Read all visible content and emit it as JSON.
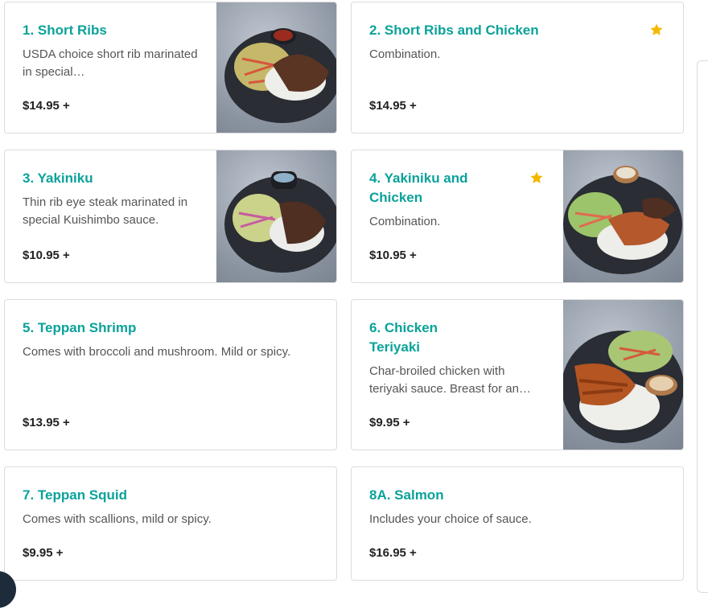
{
  "menu_items": [
    {
      "title": "1. Short Ribs",
      "description": "USDA choice short rib marinated in special…",
      "price": "$14.95 +",
      "starred": false,
      "has_photo": true
    },
    {
      "title": "2. Short Ribs and Chicken",
      "description": "Combination.",
      "price": "$14.95 +",
      "starred": true,
      "has_photo": false
    },
    {
      "title": "3. Yakiniku",
      "description": "Thin rib eye steak marinated in special Kuishimbo sauce.",
      "price": "$10.95 +",
      "starred": false,
      "has_photo": true
    },
    {
      "title": "4. Yakiniku and Chicken",
      "description": "Combination.",
      "price": "$10.95 +",
      "starred": true,
      "has_photo": true
    },
    {
      "title": "5. Teppan Shrimp",
      "description": "Comes with broccoli and mushroom. Mild or spicy.",
      "price": "$13.95 +",
      "starred": false,
      "has_photo": false
    },
    {
      "title": "6. Chicken Teriyaki",
      "description": "Char-broiled chicken with teriyaki sauce. Breast for an…",
      "price": "$9.95 +",
      "starred": false,
      "has_photo": true
    },
    {
      "title": "7. Teppan Squid",
      "description": "Comes with scallions, mild or spicy.",
      "price": "$9.95 +",
      "starred": false,
      "has_photo": false
    },
    {
      "title": "8A. Salmon",
      "description": "Includes your choice of sauce.",
      "price": "$16.95 +",
      "starred": false,
      "has_photo": false
    }
  ],
  "colors": {
    "title": "#0aa29a",
    "star": "#f5b800",
    "price": "#222222"
  },
  "icons": {
    "star": "star-icon"
  }
}
